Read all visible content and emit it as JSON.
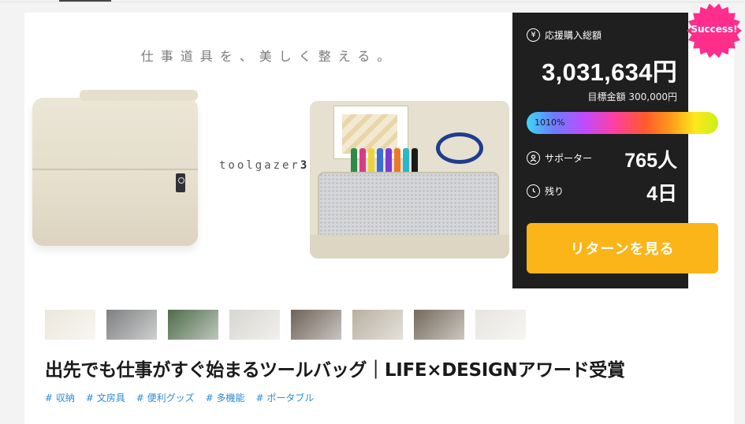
{
  "hero": {
    "tagline": "仕事道具を、美しく整える。",
    "brand_name": "toolgazer",
    "brand_num": "3"
  },
  "panel": {
    "amount_label": "応援購入総額",
    "amount": "3,031,634円",
    "goal": "目標金額 300,000円",
    "progress_text": "1010%",
    "progress_percent": 1010,
    "supporters_label": "サポーター",
    "supporters_value": "765人",
    "remaining_label": "残り",
    "remaining_value": "4日",
    "return_button": "リターンを見る"
  },
  "badge": {
    "label": "Success!",
    "color": "#ff2d8c"
  },
  "thumbnails": [
    {
      "name": "thumb-1",
      "color": "#ece7dc"
    },
    {
      "name": "thumb-2",
      "color": "#7d7f80"
    },
    {
      "name": "thumb-3",
      "color": "#4f6b4a"
    },
    {
      "name": "thumb-4",
      "color": "#d8d6d0"
    },
    {
      "name": "thumb-5",
      "color": "#6e6258"
    },
    {
      "name": "thumb-6",
      "color": "#b8b0a0"
    },
    {
      "name": "thumb-7",
      "color": "#746a5b"
    },
    {
      "name": "thumb-8",
      "color": "#e8e5df"
    }
  ],
  "project": {
    "title": "出先でも仕事がすぐ始まるツールバッグ｜LIFE×DESIGNアワード受賞",
    "tags": [
      "# 収納",
      "# 文房具",
      "# 便利グッズ",
      "# 多機能",
      "# ポータブル"
    ]
  },
  "colors": {
    "accent_button": "#fbb519",
    "panel_bg": "#1f1f1f",
    "tag_link": "#2c8bd6"
  }
}
